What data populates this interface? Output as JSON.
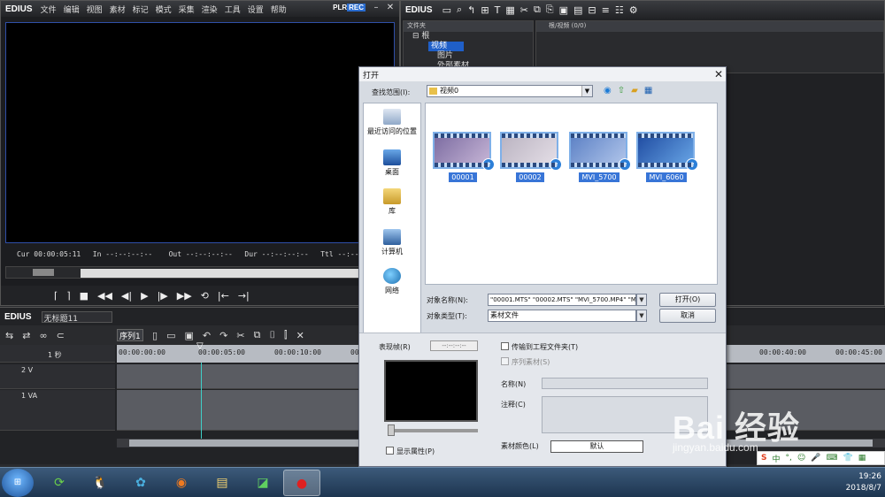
{
  "player": {
    "logo": "EDIUS",
    "menu": [
      "文件",
      "编辑",
      "视图",
      "素材",
      "标记",
      "模式",
      "采集",
      "渲染",
      "工具",
      "设置",
      "帮助"
    ],
    "plr": "PLR",
    "rec": "REC",
    "timecodes": {
      "cur": "Cur 00:00:05:11",
      "in": "In --:--:--:--",
      "out": "Out --:--:--:--",
      "dur": "Dur --:--:--:--",
      "ttl": "Ttl --:--:--:--"
    }
  },
  "bin": {
    "logo": "EDIUS",
    "tree_header": "文件夹",
    "tree": [
      "根",
      "视频",
      "图片",
      "外部素材"
    ],
    "list_header": "根/视频 (0/0)"
  },
  "timeline": {
    "logo": "EDIUS",
    "project": "无标题11",
    "sequence_tab": "序列1",
    "zoom": "1 秒",
    "ruler": [
      "00:00:00:00",
      "00:00:05:00",
      "00:00:10:00",
      "00:00:15:00",
      "00:00:40:00",
      "00:00:45:00"
    ],
    "tracks": [
      "2 V",
      "1 VA"
    ]
  },
  "dialog": {
    "title": "打开",
    "look_in_label": "查找范围(I):",
    "look_in_value": "视频0",
    "places": [
      "最近访问的位置",
      "桌面",
      "库",
      "计算机",
      "网络"
    ],
    "files": [
      {
        "name": "00001",
        "thumb_color": "#7a6aa0",
        "color2": "#c9b8d8"
      },
      {
        "name": "00002",
        "thumb_color": "#b9b2c0",
        "color2": "#e6e0e8"
      },
      {
        "name": "MVI_5700",
        "thumb_color": "#5a7fc4",
        "color2": "#b4c8ec"
      },
      {
        "name": "MVI_6060",
        "thumb_color": "#1e4aa0",
        "color2": "#6aa8e8"
      }
    ],
    "file_name_label": "对象名称(N):",
    "file_name_value": "\"00001.MTS\" \"00002.MTS\" \"MVI_5700.MP4\" \"MVI_6060.MP4\"",
    "file_type_label": "对象类型(T):",
    "file_type_value": "素材文件",
    "open_button": "打开(O)",
    "cancel_button": "取消",
    "preview_label": "表现帧(R)",
    "preview_tc": "--:--:--:--",
    "show_props": "显示属性(P)",
    "transfer": "传输到工程文件夹(T)",
    "seq_clip": "序列素材(S)",
    "name_label": "名称(N)",
    "comment_label": "注释(C)",
    "color_label": "素材颜色(L)",
    "color_value": "默认"
  },
  "watermark": {
    "brand": "Bai  经验",
    "url": "jingyan.baidu.com"
  },
  "taskbar": {
    "time": "19:26",
    "date": "2018/8/7"
  }
}
